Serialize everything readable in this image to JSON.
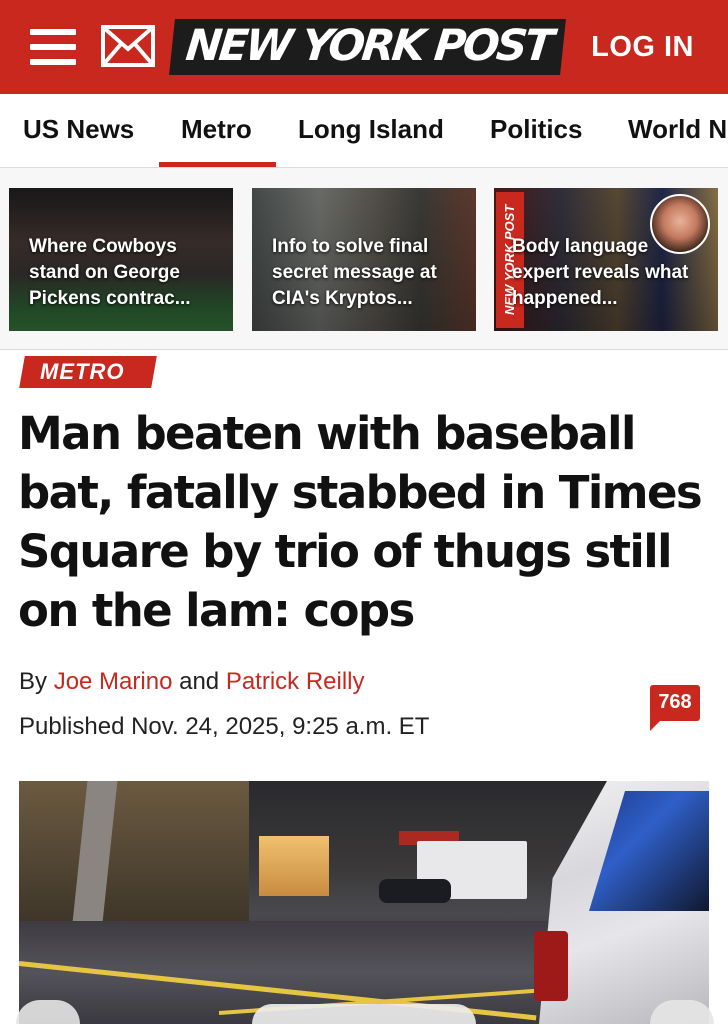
{
  "header": {
    "logo": "NEW YORK POST",
    "login_label": "LOG IN",
    "brand_color": "#c8281e"
  },
  "nav": {
    "items": [
      "US News",
      "Metro",
      "Long Island",
      "Politics",
      "World N"
    ],
    "active": "Metro"
  },
  "trending": [
    {
      "caption": "Where Cowboys stand on George Pickens contrac..."
    },
    {
      "caption": "Info to solve final secret message at CIA's Kryptos..."
    },
    {
      "caption": "Body language expert reveals what happened...",
      "badge": "NEW YORK POST"
    }
  ],
  "article": {
    "section": "METRO",
    "headline": "Man beaten with baseball bat, fatally stabbed in Times Square by trio of thugs still on the lam: cops",
    "byline_prefix": "By",
    "author1": "Joe Marino",
    "byline_join": "and",
    "author2": "Patrick Reilly",
    "published": "Published Nov. 24, 2025, 9:25 a.m. ET",
    "comment_count": "768"
  },
  "icons": [
    "menu-icon",
    "mail-icon",
    "comment-bubble-icon"
  ]
}
